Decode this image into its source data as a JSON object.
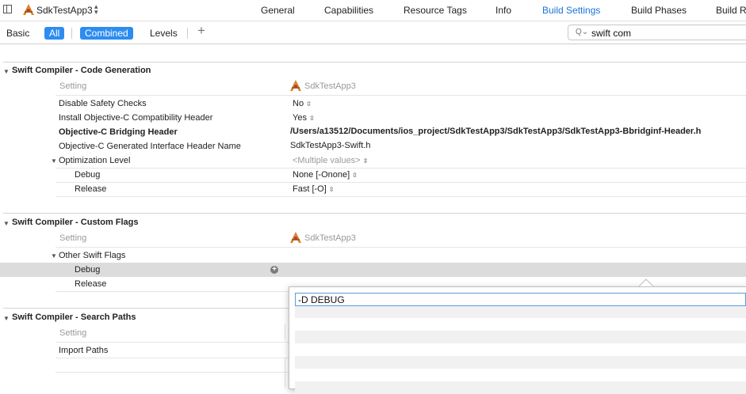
{
  "topbar": {
    "target_name": "SdkTestApp3",
    "tabs": [
      "General",
      "Capabilities",
      "Resource Tags",
      "Info",
      "Build Settings",
      "Build Phases",
      "Build R"
    ],
    "active_tab": "Build Settings"
  },
  "filterbar": {
    "basic": "Basic",
    "all": "All",
    "combined": "Combined",
    "levels": "Levels",
    "add": "+",
    "search_value": "swift com",
    "search_icon": "Q⌄"
  },
  "sections": {
    "codegen": {
      "title": "Swift Compiler - Code Generation",
      "setting_header": "Setting",
      "target_header": "SdkTestApp3",
      "rows": [
        {
          "label": "Disable Safety Checks",
          "value": "No"
        },
        {
          "label": "Install Objective-C Compatibility Header",
          "value": "Yes"
        },
        {
          "label": "Objective-C Bridging Header",
          "value": "/Users/a13512/Documents/ios_project/SdkTestApp3/SdkTestApp3/SdkTestApp3-Bbridginf-Header.h"
        },
        {
          "label": "Objective-C Generated Interface Header Name",
          "value": "SdkTestApp3-Swift.h"
        },
        {
          "label": "Optimization Level",
          "value": "<Multiple values>"
        },
        {
          "label": "Debug",
          "value": "None [-Onone]"
        },
        {
          "label": "Release",
          "value": "Fast [-O]"
        }
      ]
    },
    "custom_flags": {
      "title": "Swift Compiler - Custom Flags",
      "setting_header": "Setting",
      "target_header": "SdkTestApp3",
      "rows": [
        {
          "label": "Other Swift Flags"
        },
        {
          "label": "Debug"
        },
        {
          "label": "Release"
        }
      ]
    },
    "search_paths": {
      "title": "Swift Compiler - Search Paths",
      "setting_header": "Setting",
      "rows": [
        {
          "label": "Import Paths"
        }
      ]
    }
  },
  "popover": {
    "entries": [
      "-D DEBUG"
    ]
  },
  "colors": {
    "accent": "#1a73d9",
    "selected_button": "#2d8cf0",
    "selected_row": "#dcdcdc"
  }
}
